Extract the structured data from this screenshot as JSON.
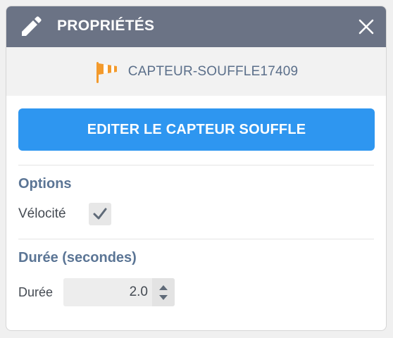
{
  "header": {
    "title": "PROPRIÉTÉS",
    "icon": "pencil-icon",
    "close_icon": "close-icon"
  },
  "sensor": {
    "icon": "windsock-icon",
    "name": "CAPTEUR-SOUFFLE17409"
  },
  "actions": {
    "edit_label": "EDITER LE CAPTEUR SOUFFLE"
  },
  "options": {
    "section_title": "Options",
    "velocity_label": "Vélocité",
    "velocity_checked": true
  },
  "duration": {
    "section_title": "Durée (secondes)",
    "field_label": "Durée",
    "value": "2.0"
  },
  "colors": {
    "header_bg": "#6b7385",
    "accent_button": "#2e96f0",
    "section_title": "#5b7595",
    "windsock_orange": "#f39a2c"
  }
}
